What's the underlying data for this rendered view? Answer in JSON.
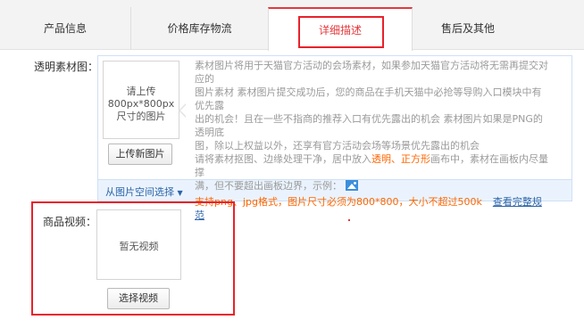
{
  "tabs": [
    {
      "label": "产品信息",
      "active": false
    },
    {
      "label": "价格库存物流",
      "active": false
    },
    {
      "label": "详细描述",
      "active": true
    },
    {
      "label": "售后及其他",
      "active": false
    }
  ],
  "transparent_image": {
    "label": "透明素材图：",
    "placeholder_line1": "请上传",
    "placeholder_line2": "800px*800px",
    "placeholder_line3": "尺寸的图片",
    "upload_button": "上传新图片",
    "from_space_link": "从图片空间选择",
    "desc_line1": "素材图片将用于天猫官方活动的会场素材，如果参加天猫官方活动将无需再提交对应的",
    "desc_line2": "图片素材 素材图片提交成功后，您的商品在手机天猫中必抢等导购入口模块中有优先露",
    "desc_line3": "出的机会！且在一些不指商的推荐入口有优先露出的机会 素材图片如果是PNG的透明底",
    "desc_line4": "图，除以上权益以外，还享有官方活动会场等场景优先露出的机会",
    "desc_line5a": "请将素材抠图、边缘处理干净，居中放入",
    "desc_line5_hl1": "透明",
    "desc_line5_sep": "、",
    "desc_line5_hl2": "正方形",
    "desc_line5b": "画布中，素材在画板内尽量撑",
    "desc_line6": "满，但不要超出画板边界，示例：",
    "format_note": "支持png、jpg格式，图片尺寸必须为800*800，大小不超过500k",
    "view_spec_link": "查看完整规范",
    "colors": {
      "highlight": "#ff6600",
      "link": "#2c64a8"
    }
  },
  "product_video": {
    "label": "商品视频：",
    "empty_text": "暂无视频",
    "select_button": "选择视频"
  },
  "accent_color": "#e4393c"
}
